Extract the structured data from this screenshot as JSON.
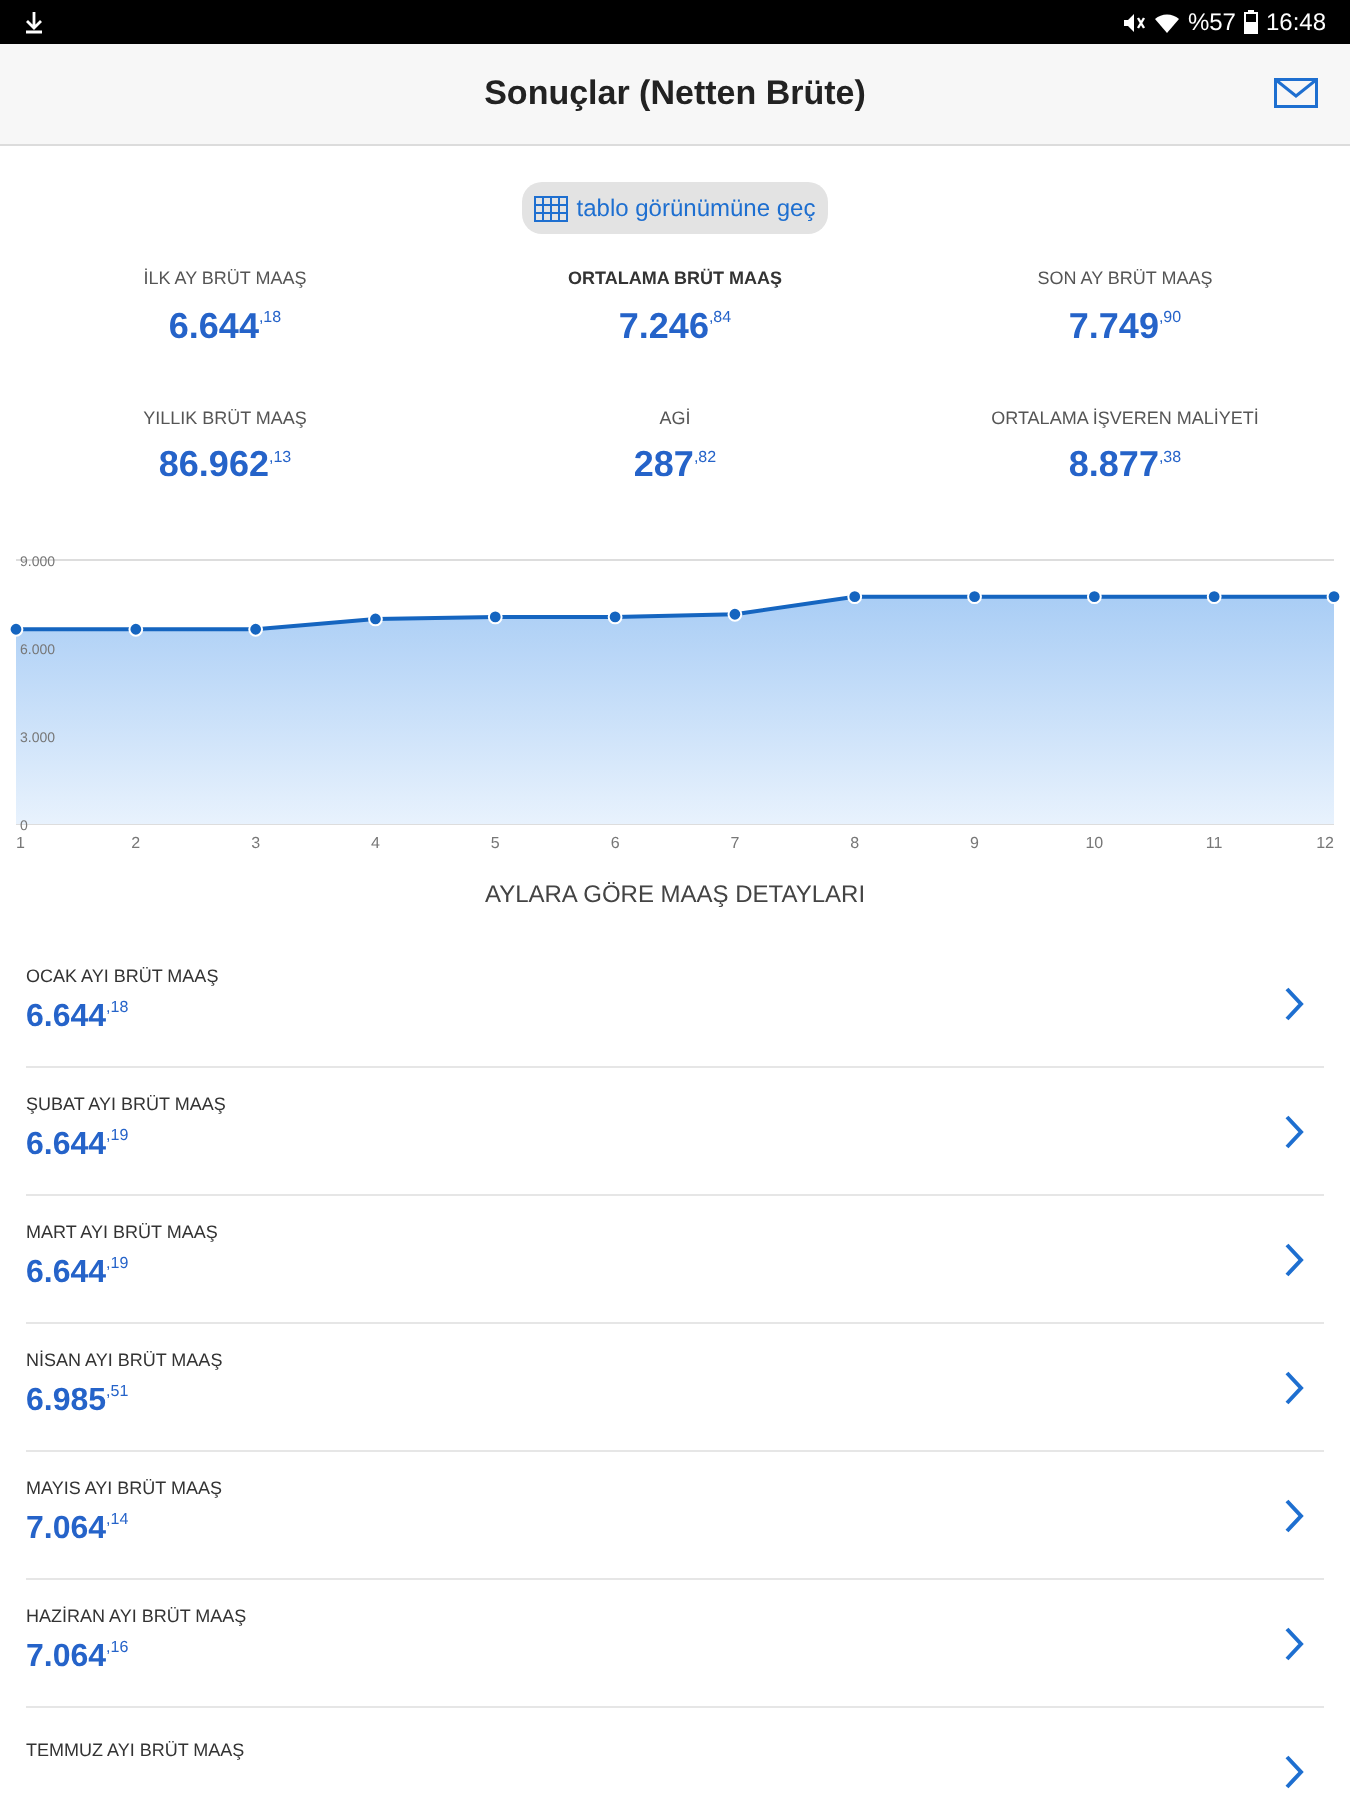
{
  "status_bar": {
    "battery": "%57",
    "time": "16:48"
  },
  "header": {
    "title": "Sonuçlar (Netten Brüte)"
  },
  "view_toggle": {
    "label": "tablo görünümüne geç"
  },
  "summary": [
    {
      "label": "İLK AY BRÜT MAAŞ",
      "value": "6.644$^{,18}$",
      "emphasis": false
    },
    {
      "label": "ORTALAMA BRÜT MAAŞ",
      "value": "7.246$^{,84}$",
      "emphasis": true
    },
    {
      "label": "SON AY BRÜT MAAŞ",
      "value": "7.749$^{,90}$",
      "emphasis": false
    },
    {
      "label": "YILLIK BRÜT MAAŞ",
      "value": "86.962$^{,13}$",
      "emphasis": false
    },
    {
      "label": "AGİ",
      "value": "287$^{,82}$",
      "emphasis": false
    },
    {
      "label": "ORTALAMA İŞVEREN MALİYETİ",
      "value": "8.877$^{,38}$",
      "emphasis": false
    }
  ],
  "chart_data": {
    "type": "area",
    "x": [
      1,
      2,
      3,
      4,
      5,
      6,
      7,
      8,
      9,
      10,
      11,
      12
    ],
    "series": [
      {
        "color": "#1565c0",
        "values": [
          6640,
          6640,
          6640,
          6990,
          7060,
          7060,
          7150,
          7750,
          7750,
          7750,
          7750,
          7750
        ]
      }
    ],
    "ylim": [
      0,
      9000
    ],
    "xlim": [
      1,
      12
    ],
    "yticks": [
      {
        "value": 0,
        "label": "0"
      },
      {
        "value": 3000,
        "label": "3.000"
      },
      {
        "value": 6000,
        "label": "6.000"
      },
      {
        "value": 9000,
        "label": "9.000"
      }
    ],
    "xticks": [
      1,
      2,
      3,
      4,
      5,
      6,
      7,
      8,
      9,
      10,
      11,
      12
    ]
  },
  "section_title": "AYLARA GÖRE MAAŞ DETAYLARI",
  "months": [
    {
      "label": "OCAK AYI BRÜT MAAŞ",
      "value": "6.644$^{,18}$"
    },
    {
      "label": "ŞUBAT AYI BRÜT MAAŞ",
      "value": "6.644$^{,19}$"
    },
    {
      "label": "MART AYI BRÜT MAAŞ",
      "value": "6.644$^{,19}$"
    },
    {
      "label": "NİSAN AYI BRÜT MAAŞ",
      "value": "6.985$^{,51}$"
    },
    {
      "label": "MAYIS AYI BRÜT MAAŞ",
      "value": "7.064$^{,14}$"
    },
    {
      "label": "HAZİRAN AYI BRÜT MAAŞ",
      "value": "7.064$^{,16}$"
    },
    {
      "label": "TEMMUZ AYI BRÜT MAAŞ"
    }
  ]
}
